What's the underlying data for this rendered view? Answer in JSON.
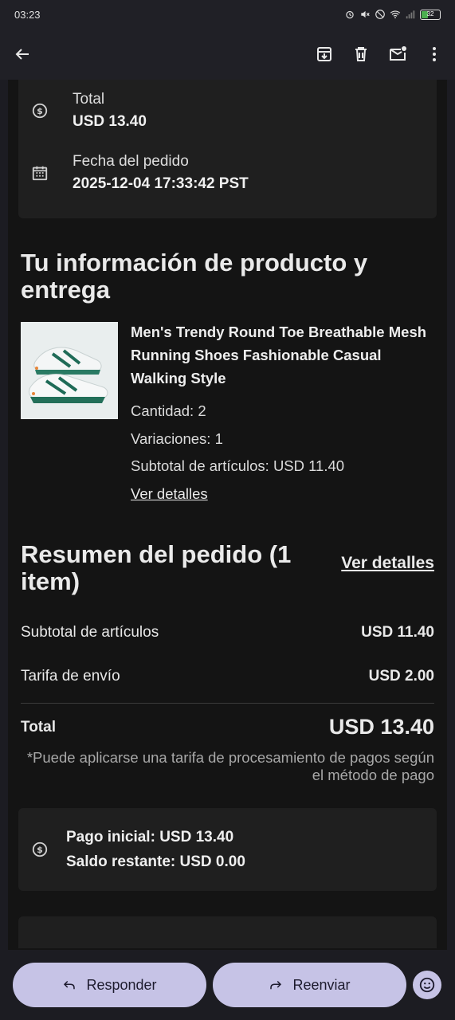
{
  "status": {
    "time": "03:23",
    "battery": "32"
  },
  "top_card": {
    "total_label": "Total",
    "total_value": "USD 13.40",
    "date_label": "Fecha del pedido",
    "date_value": "2025-12-04 17:33:42 PST"
  },
  "product_section": {
    "heading": "Tu información de producto y entrega",
    "product": {
      "name": "Men's Trendy Round Toe Breathable Mesh Running Shoes Fashionable Casual Walking Style",
      "quantity": "Cantidad: 2",
      "variations": "Variaciones: 1",
      "subtotal": "Subtotal de artículos: USD 11.40",
      "details_link": "Ver detalles"
    }
  },
  "summary": {
    "heading": "Resumen del pedido (1 item)",
    "details_link": "Ver detalles",
    "subtotal_label": "Subtotal de artículos",
    "subtotal_value": "USD 11.40",
    "shipping_label": "Tarifa de envío",
    "shipping_value": "USD 2.00",
    "total_label": "Total",
    "total_value": "USD 13.40",
    "note": "*Puede aplicarse una tarifa de procesamiento de pagos según el método de pago"
  },
  "payment": {
    "initial": "Pago inicial: USD 13.40",
    "remaining": "Saldo restante: USD 0.00"
  },
  "actions": {
    "reply": "Responder",
    "forward": "Reenviar"
  },
  "colors": {
    "accent_pill": "#c6c3e6",
    "background": "#141414",
    "card": "#1f1f1f"
  },
  "icons": [
    "back-arrow-icon",
    "archive-icon",
    "delete-icon",
    "mark-unread-icon",
    "more-vert-icon",
    "dollar-circle-icon",
    "calendar-icon",
    "reply-icon",
    "forward-icon",
    "emoji-icon"
  ]
}
